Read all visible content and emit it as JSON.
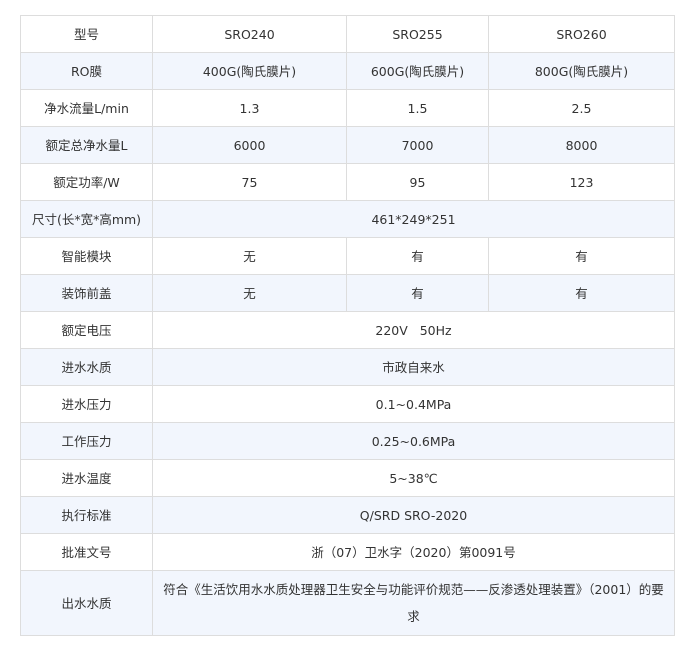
{
  "table": {
    "rows": [
      {
        "label": "型号",
        "cells": [
          "SRO240",
          "SRO255",
          "SRO260"
        ]
      },
      {
        "label": "RO膜",
        "cells": [
          "400G(陶氏膜片)",
          "600G(陶氏膜片)",
          "800G(陶氏膜片)"
        ]
      },
      {
        "label": "净水流量L/min",
        "cells": [
          "1.3",
          "1.5",
          "2.5"
        ]
      },
      {
        "label": "额定总净水量L",
        "cells": [
          "6000",
          "7000",
          "8000"
        ]
      },
      {
        "label": "额定功率/W",
        "cells": [
          "75",
          "95",
          "123"
        ]
      },
      {
        "label": "尺寸(长*宽*高mm)",
        "cells": [
          "461*249*251"
        ]
      },
      {
        "label": "智能模块",
        "cells": [
          "无",
          "有",
          "有"
        ]
      },
      {
        "label": "装饰前盖",
        "cells": [
          "无",
          "有",
          "有"
        ]
      },
      {
        "label": "额定电压",
        "cells": [
          "220V   50Hz"
        ]
      },
      {
        "label": "进水水质",
        "cells": [
          "市政自来水"
        ]
      },
      {
        "label": "进水压力",
        "cells": [
          "0.1~0.4MPa"
        ]
      },
      {
        "label": "工作压力",
        "cells": [
          "0.25~0.6MPa"
        ]
      },
      {
        "label": "进水温度",
        "cells": [
          "5~38℃"
        ]
      },
      {
        "label": "执行标准",
        "cells": [
          "Q/SRD SRO-2020"
        ]
      },
      {
        "label": "批准文号",
        "cells": [
          "浙（07）卫水字（2020）第0091号"
        ]
      },
      {
        "label": "出水水质",
        "cells": [
          "符合《生活饮用水水质处理器卫生安全与功能评价规范——反渗透处理装置》（2001）的要求"
        ]
      }
    ]
  },
  "colors": {
    "border": "#dddddd",
    "alt_row_bg": "#f2f6fd",
    "text": "#333333"
  }
}
